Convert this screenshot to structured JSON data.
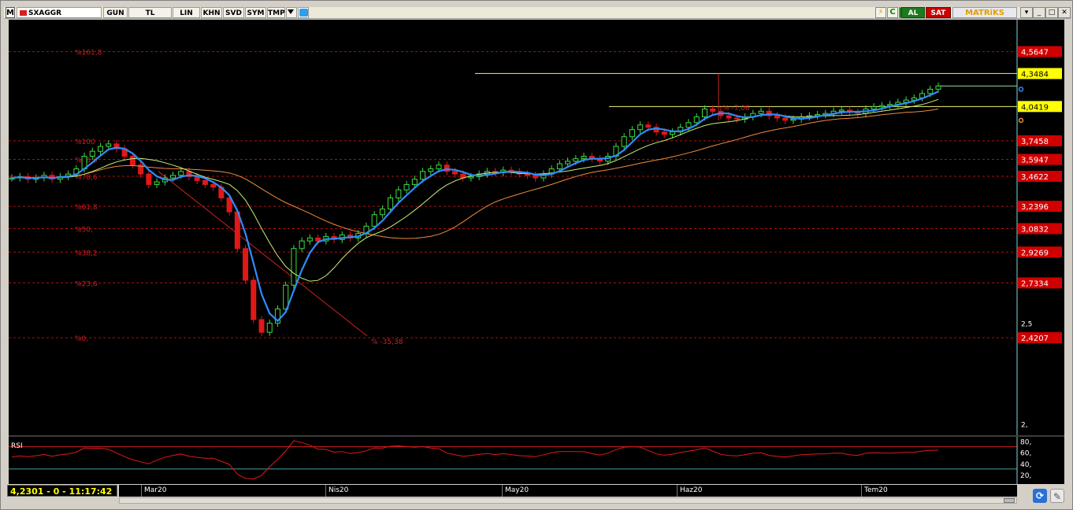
{
  "toolbar": {
    "logo": "M",
    "symbol": "SXAGGR",
    "buttons": [
      "GUN",
      "TL",
      "LIN",
      "KHN",
      "SVD",
      "SYM",
      "TMP"
    ],
    "al": "AL",
    "sat": "SAT",
    "brand_left": "MATR",
    "brand_mid": "i",
    "brand_right": "KS",
    "c_icon": "C"
  },
  "status": "4,2301 - 0 - 11:17:42",
  "x_axis": [
    "Mar20",
    "Nis20",
    "May20",
    "Haz20",
    "Tem20"
  ],
  "rsi": {
    "label": "RSI",
    "ticks": [
      "80,",
      "60,",
      "40,",
      "20,"
    ]
  },
  "colors": {
    "up": "#3fdc3f",
    "down": "#e01818",
    "ma_fast": "#2f8cff",
    "ma_mid": "#c8f07a",
    "ma_slow": "#f08c3c",
    "fib": "#b01010",
    "highlight": "#ffff00"
  },
  "chart_data": {
    "type": "candlestick",
    "price_axis": {
      "ticks": [
        "2,5",
        "2,"
      ],
      "range": [
        1.95,
        4.9
      ]
    },
    "price_labels": [
      {
        "value": "4,5647",
        "style": "red"
      },
      {
        "value": "4,3484",
        "style": "yellow"
      },
      {
        "value": "4,0419",
        "style": "yellow"
      },
      {
        "value": "3,7458",
        "style": "red"
      },
      {
        "value": "3,5947",
        "style": "red"
      },
      {
        "value": "3,4622",
        "style": "red"
      },
      {
        "value": "3,2396",
        "style": "red"
      },
      {
        "value": "3,0832",
        "style": "red"
      },
      {
        "value": "2,9269",
        "style": "red"
      },
      {
        "value": "2,7334",
        "style": "red"
      },
      {
        "value": "2,4207",
        "style": "red"
      }
    ],
    "fibonacci": [
      {
        "label": "%161,8",
        "value": 4.5647
      },
      {
        "label": "%100",
        "value": 3.7458
      },
      {
        "label": "%88,6",
        "value": 3.5947
      },
      {
        "label": "%78,6",
        "value": 3.4622
      },
      {
        "label": "%61,8",
        "value": 3.2396
      },
      {
        "label": "%50,",
        "value": 3.0832
      },
      {
        "label": "%38,2",
        "value": 2.9269
      },
      {
        "label": "%23,6",
        "value": 2.7334
      },
      {
        "label": "%0,",
        "value": 2.4207
      }
    ],
    "annotations": [
      "% -35,38",
      "% -7,06"
    ],
    "levels": [
      4.3484,
      4.0419
    ],
    "closes": [
      3.45,
      3.46,
      3.44,
      3.45,
      3.47,
      3.44,
      3.46,
      3.48,
      3.52,
      3.62,
      3.66,
      3.7,
      3.72,
      3.68,
      3.62,
      3.55,
      3.48,
      3.4,
      3.42,
      3.45,
      3.47,
      3.5,
      3.46,
      3.43,
      3.4,
      3.38,
      3.3,
      3.2,
      2.95,
      2.75,
      2.52,
      2.45,
      2.5,
      2.58,
      2.72,
      2.95,
      3.0,
      3.02,
      3.0,
      3.03,
      3.01,
      3.04,
      3.02,
      3.05,
      3.1,
      3.18,
      3.22,
      3.3,
      3.36,
      3.4,
      3.44,
      3.5,
      3.52,
      3.55,
      3.5,
      3.48,
      3.45,
      3.46,
      3.48,
      3.5,
      3.49,
      3.51,
      3.5,
      3.48,
      3.47,
      3.45,
      3.48,
      3.52,
      3.56,
      3.58,
      3.6,
      3.62,
      3.6,
      3.58,
      3.62,
      3.7,
      3.78,
      3.84,
      3.88,
      3.86,
      3.82,
      3.8,
      3.82,
      3.86,
      3.9,
      3.95,
      4.02,
      4.0,
      3.96,
      3.94,
      3.93,
      3.95,
      3.98,
      4.0,
      3.96,
      3.94,
      3.92,
      3.93,
      3.95,
      3.96,
      3.97,
      3.98,
      4.0,
      4.01,
      3.99,
      3.98,
      4.02,
      4.04,
      4.05,
      4.06,
      4.08,
      4.1,
      4.12,
      4.16,
      4.2,
      4.23
    ]
  }
}
